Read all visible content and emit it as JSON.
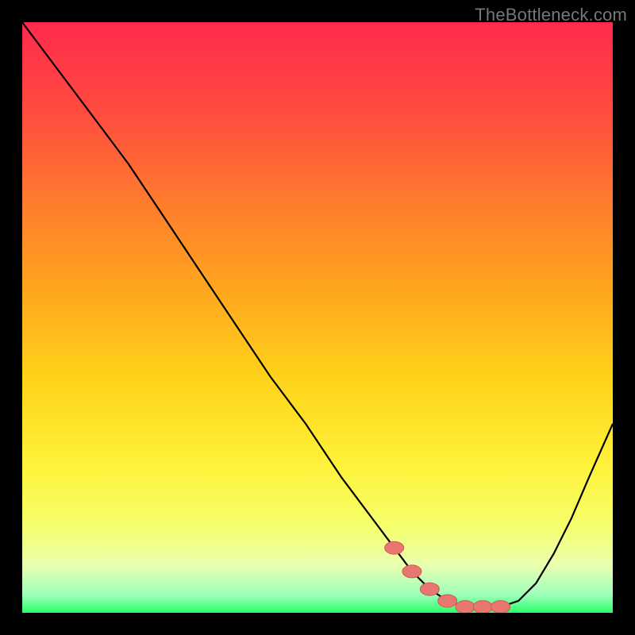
{
  "watermark": "TheBottleneck.com",
  "chart_data": {
    "type": "line",
    "title": "",
    "xlabel": "",
    "ylabel": "",
    "xlim": [
      0,
      100
    ],
    "ylim": [
      0,
      100
    ],
    "grid": false,
    "series": [
      {
        "name": "bottleneck-curve",
        "x": [
          0,
          6,
          12,
          18,
          24,
          30,
          36,
          42,
          48,
          54,
          60,
          63,
          66,
          69,
          72,
          75,
          78,
          81,
          84,
          87,
          90,
          93,
          96,
          100
        ],
        "y": [
          100,
          92,
          84,
          76,
          67,
          58,
          49,
          40,
          32,
          23,
          15,
          11,
          7,
          4,
          2,
          1,
          1,
          1,
          2,
          5,
          10,
          16,
          23,
          32
        ]
      }
    ],
    "colors": {
      "curve": "#000000",
      "marker_fill": "#e8776f",
      "marker_stroke": "#d05a52",
      "gradient_stops": [
        {
          "offset": 0.0,
          "color": "#ff2a4d"
        },
        {
          "offset": 0.15,
          "color": "#ff4b3f"
        },
        {
          "offset": 0.3,
          "color": "#ff7a2e"
        },
        {
          "offset": 0.45,
          "color": "#ffa51e"
        },
        {
          "offset": 0.6,
          "color": "#ffd21a"
        },
        {
          "offset": 0.75,
          "color": "#fff23a"
        },
        {
          "offset": 0.85,
          "color": "#f6ff6a"
        },
        {
          "offset": 0.92,
          "color": "#e9ffb0"
        },
        {
          "offset": 0.97,
          "color": "#9cffba"
        },
        {
          "offset": 1.0,
          "color": "#2bff68"
        }
      ],
      "frame": "#000000"
    },
    "markers": {
      "x": [
        63,
        66,
        69,
        72,
        75,
        78,
        81
      ],
      "y": [
        11,
        7,
        4,
        2,
        1,
        1,
        1
      ]
    }
  }
}
